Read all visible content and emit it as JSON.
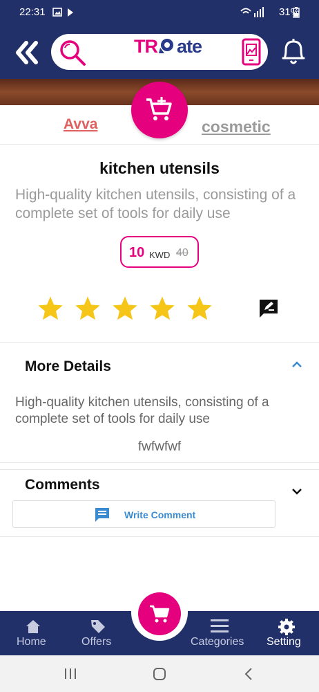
{
  "status_bar": {
    "time": "22:31",
    "battery": "31%"
  },
  "header": {
    "logo_left": "TR",
    "logo_right": "ate"
  },
  "tabs": {
    "store": "Avva",
    "category": "cosmetic"
  },
  "product": {
    "title": "kitchen utensils",
    "description": "High-quality kitchen utensils, consisting of a complete set of tools for daily use",
    "price": "10",
    "currency": "KWD",
    "old_price": "40",
    "rating": 5
  },
  "details": {
    "title": "More Details",
    "text": "High-quality kitchen utensils, consisting of a complete set of tools for daily use",
    "extra": "fwfwfwf"
  },
  "comments": {
    "title": "Comments",
    "write_label": "Write Comment"
  },
  "bottom_nav": {
    "home": "Home",
    "offers": "Offers",
    "categories": "Categories",
    "setting": "Setting"
  },
  "colors": {
    "brand": "#22306a",
    "accent": "#e5007d",
    "star": "#f5c518"
  }
}
